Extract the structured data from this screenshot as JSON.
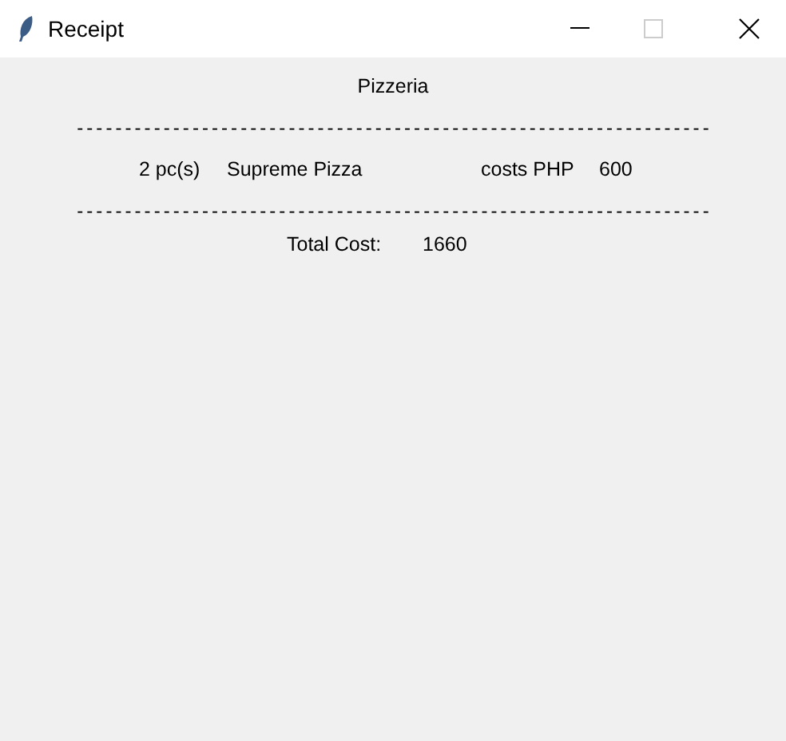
{
  "window": {
    "title": "Receipt"
  },
  "shop_name": "Pizzeria",
  "separators": [
    "------------------------------------------------------------------",
    "------------------------------------------------------------------"
  ],
  "items": [
    {
      "quantity": "2 pc(s)",
      "name": "Supreme Pizza",
      "price_label": "costs PHP",
      "price": "600"
    }
  ],
  "total": {
    "label": "Total Cost:",
    "value": "1660"
  }
}
